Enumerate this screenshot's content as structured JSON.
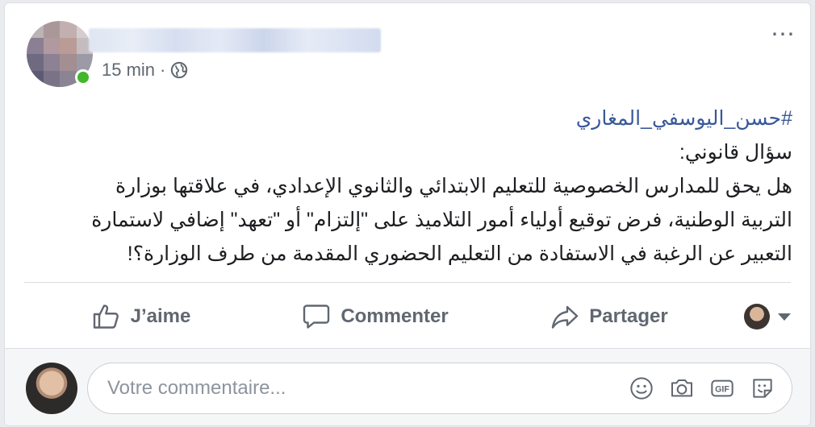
{
  "post": {
    "time": "15 min",
    "separator": "·",
    "hashtag": "#حسن_اليوسفي_المغاري",
    "lines": [
      "سؤال قانوني:",
      "هل يحق للمدارس الخصوصية للتعليم الابتدائي والثانوي الإعدادي، في علاقتها بوزارة",
      "التربية الوطنية، فرض توقيع أولياء أمور التلاميذ على \"إلتزام\" أو \"تعهد\" إضافي لاستمارة",
      "التعبير عن الرغبة في الاستفادة من التعليم الحضوري المقدمة من طرف الوزارة؟!"
    ],
    "more_icon": "⋯"
  },
  "actions": {
    "like": "J’aime",
    "comment": "Commenter",
    "share": "Partager"
  },
  "comment": {
    "placeholder": "Votre commentaire..."
  },
  "colors": {
    "link": "#385898",
    "text": "#1c1e21",
    "muted": "#606770",
    "online": "#42b72a"
  }
}
